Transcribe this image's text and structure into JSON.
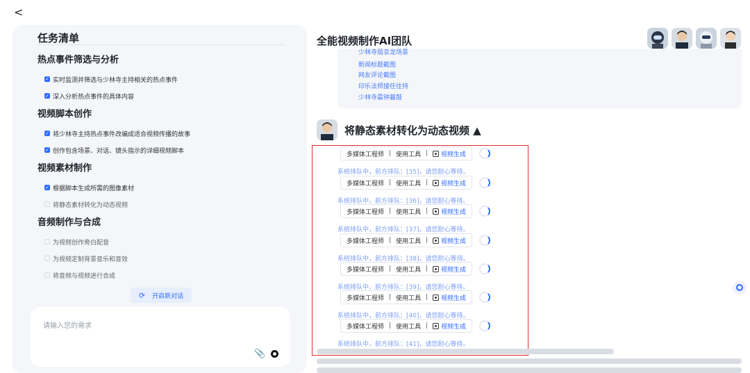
{
  "nav": {
    "back_glyph": "<"
  },
  "tasks": {
    "title": "任务清单",
    "sections": [
      {
        "title": "热点事件筛选与分析",
        "items": [
          {
            "label": "实时监测并筛选与少林寺主持相关的热点事件",
            "done": true
          },
          {
            "label": "深入分析热点事件的具体内容",
            "done": true
          }
        ]
      },
      {
        "title": "视频脚本创作",
        "items": [
          {
            "label": "将少林寺主持热点事件改编成适合视频传播的故事",
            "done": true
          },
          {
            "label": "创作包含场景、对话、镜头指示的详细视频脚本",
            "done": true
          }
        ]
      },
      {
        "title": "视频素材制作",
        "items": [
          {
            "label": "根据脚本生成所需的图像素材",
            "done": true
          },
          {
            "label": "将静态素材转化为动态视频",
            "done": false
          }
        ]
      },
      {
        "title": "音频制作与合成",
        "items": [
          {
            "label": "为视频创作旁白配音",
            "done": false
          },
          {
            "label": "为视频定制背景音乐和音效",
            "done": false
          },
          {
            "label": "将音频与视频进行合成",
            "done": false
          }
        ]
      }
    ],
    "new_chat_label": "开启新对话",
    "input_placeholder": "请输入您的需求"
  },
  "main": {
    "title": "全能视频制作AI团队",
    "media_links": [
      "少林寺局亚龙场景",
      "新闻标题截图",
      "网友评论截图",
      "印乐法师接任住持",
      "少林寺晨钟暮鼓"
    ],
    "step_title": "将静态素材转化为动态视频 ▲",
    "tool_rows": [
      {
        "role": "多媒体工程师",
        "tool_label": "使用工具",
        "tool": "视频生成"
      },
      {
        "role": "多媒体工程师",
        "tool_label": "使用工具",
        "tool": "视频生成"
      },
      {
        "role": "多媒体工程师",
        "tool_label": "使用工具",
        "tool": "视频生成"
      },
      {
        "role": "多媒体工程师",
        "tool_label": "使用工具",
        "tool": "视频生成"
      },
      {
        "role": "多媒体工程师",
        "tool_label": "使用工具",
        "tool": "视频生成"
      },
      {
        "role": "多媒体工程师",
        "tool_label": "使用工具",
        "tool": "视频生成"
      },
      {
        "role": "多媒体工程师",
        "tool_label": "使用工具",
        "tool": "视频生成"
      }
    ],
    "queue_msgs": [
      "系统排队中，前方排队：[35]，请您耐心等待。",
      "系统排队中，前方排队：[36]，请您耐心等待。",
      "系统排队中，前方排队：[37]，请您耐心等待。",
      "系统排队中，前方排队：[38]，请您耐心等待。",
      "系统排队中，前方排队：[39]，请您耐心等待。",
      "系统排队中，前方排队：[40]，请您耐心等待。",
      "系统排队中，前方排队：[41]，请您耐心等待。"
    ]
  },
  "colors": {
    "accent": "#2f6bff",
    "highlight": "#e02a2a",
    "queue_text": "#7a9ef5",
    "panel_bg": "#f4f6f9"
  }
}
